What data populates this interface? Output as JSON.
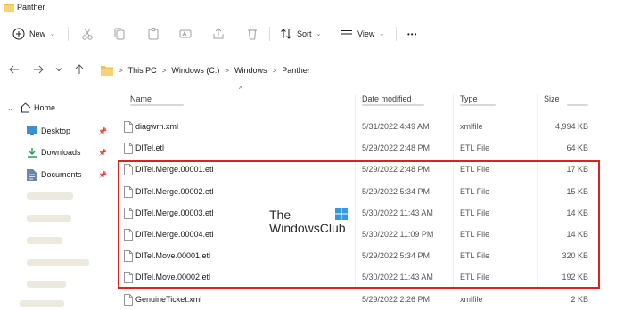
{
  "window": {
    "title": "Panther"
  },
  "toolbar": {
    "new_label": "New",
    "sort_label": "Sort",
    "view_label": "View",
    "more_label": "•••"
  },
  "address": {
    "crumbs": [
      "This PC",
      "Windows (C:)",
      "Windows",
      "Panther"
    ]
  },
  "nav": {
    "home": "Home",
    "items": [
      {
        "label": "Desktop",
        "icon": "desktop-icon"
      },
      {
        "label": "Downloads",
        "icon": "download-icon"
      },
      {
        "label": "Documents",
        "icon": "documents-icon"
      }
    ]
  },
  "columns": {
    "name": "Name",
    "date": "Date modified",
    "type": "Type",
    "size": "Size"
  },
  "files": [
    {
      "name": "diagwrn.xml",
      "date": "5/31/2022 4:49 AM",
      "type": "xmlfile",
      "size": "4,994 KB"
    },
    {
      "name": "DlTel.etl",
      "date": "5/29/2022 2:48 PM",
      "type": "ETL File",
      "size": "64 KB"
    },
    {
      "name": "DlTel.Merge.00001.etl",
      "date": "5/29/2022 2:48 PM",
      "type": "ETL File",
      "size": "17 KB"
    },
    {
      "name": "DlTel.Merge.00002.etl",
      "date": "5/29/2022 5:34 PM",
      "type": "ETL File",
      "size": "15 KB"
    },
    {
      "name": "DlTel.Merge.00003.etl",
      "date": "5/30/2022 11:43 AM",
      "type": "ETL File",
      "size": "14 KB"
    },
    {
      "name": "DlTel.Merge.00004.etl",
      "date": "5/30/2022 11:09 PM",
      "type": "ETL File",
      "size": "14 KB"
    },
    {
      "name": "DlTel.Move.00001.etl",
      "date": "5/29/2022 5:34 PM",
      "type": "ETL File",
      "size": "320 KB"
    },
    {
      "name": "DlTel.Move.00002.etl",
      "date": "5/30/2022 11:43 AM",
      "type": "ETL File",
      "size": "192 KB"
    },
    {
      "name": "GenuineTicket.xml",
      "date": "5/29/2022 2:26 PM",
      "type": "xmlfile",
      "size": "2 KB"
    }
  ],
  "watermark": {
    "line1": "The",
    "line2": "WindowsClub"
  },
  "colors": {
    "highlight": "#e0201a",
    "folder": "#f4c04e",
    "accent": "#0067c0"
  }
}
